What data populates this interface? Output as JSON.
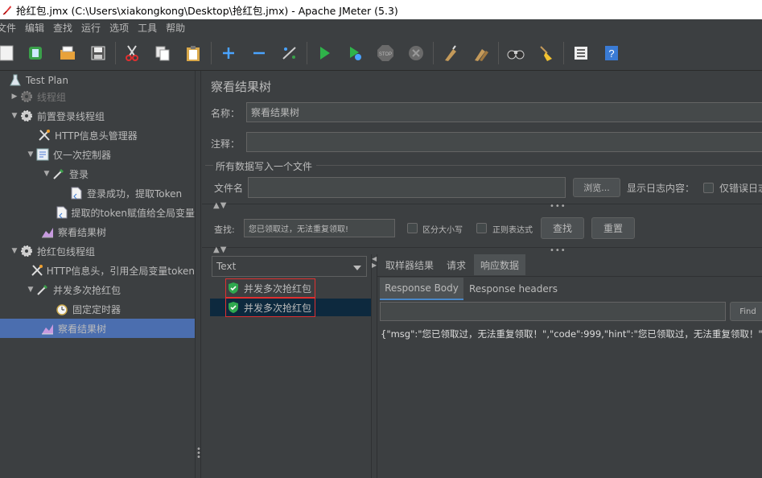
{
  "window": {
    "title": "抢红包.jmx (C:\\Users\\xiakongkong\\Desktop\\抢红包.jmx) - Apache JMeter (5.3)"
  },
  "menu": [
    "文件",
    "编辑",
    "查找",
    "运行",
    "选项",
    "工具",
    "帮助"
  ],
  "tree": [
    {
      "label": "Test Plan",
      "icon": "flask-icon",
      "disabled": false
    },
    {
      "label": "线程组",
      "icon": "gear-icon",
      "disabled": true
    },
    {
      "label": "前置登录线程组",
      "icon": "gear-icon",
      "disabled": false
    },
    {
      "label": "HTTP信息头管理器",
      "icon": "wrench-icon",
      "disabled": false
    },
    {
      "label": "仅一次控制器",
      "icon": "controller-icon",
      "disabled": false
    },
    {
      "label": "登录",
      "icon": "pipette-icon",
      "disabled": false
    },
    {
      "label": "登录成功，提取Token",
      "icon": "document-icon",
      "disabled": false
    },
    {
      "label": "提取的token赋值给全局变量",
      "icon": "document-icon",
      "disabled": false
    },
    {
      "label": "察看结果树",
      "icon": "chart-icon",
      "disabled": false
    },
    {
      "label": "抢红包线程组",
      "icon": "gear-icon",
      "disabled": false
    },
    {
      "label": "HTTP信息头，引用全局变量token",
      "icon": "wrench-icon",
      "disabled": false
    },
    {
      "label": "并发多次抢红包",
      "icon": "pipette-icon",
      "disabled": false
    },
    {
      "label": "固定定时器",
      "icon": "timer-icon",
      "disabled": false
    },
    {
      "label": "察看结果树",
      "icon": "chart-icon",
      "disabled": false
    }
  ],
  "panel": {
    "title": "察看结果树",
    "name_label": "名称：",
    "name_value": "察看结果树",
    "comment_label": "注释：",
    "comment_value": "",
    "section_label": "所有数据写入一个文件",
    "file_label": "文件名",
    "file_value": "",
    "browse_label": "浏览...",
    "log_label": "显示日志内容：",
    "errors_only_label": "仅错误日志",
    "search_label": "查找:",
    "search_value": "您已领取过，无法重复领取!",
    "case_label": "区分大小写",
    "regex_label": "正则表达式",
    "find_button": "查找",
    "reset_button": "重置",
    "renderer_value": "Text",
    "results": [
      {
        "label": "并发多次抢红包",
        "status": "success"
      },
      {
        "label": "并发多次抢红包",
        "status": "success"
      }
    ],
    "tabs": [
      "取样器结果",
      "请求",
      "响应数据"
    ],
    "active_tab": "响应数据",
    "subtabs": [
      "Response Body",
      "Response headers"
    ],
    "active_subtab": "Response Body",
    "find_small_button": "Find",
    "response_text": "{\"msg\":\"您已领取过，无法重复领取！\",\"code\":999,\"hint\":\"您已领取过，无法重复领取！\"}"
  },
  "colors": {
    "background": "#3c3f41",
    "selection": "#4b6eaf",
    "highlight_border": "#e03030",
    "success": "#2fa84f"
  }
}
